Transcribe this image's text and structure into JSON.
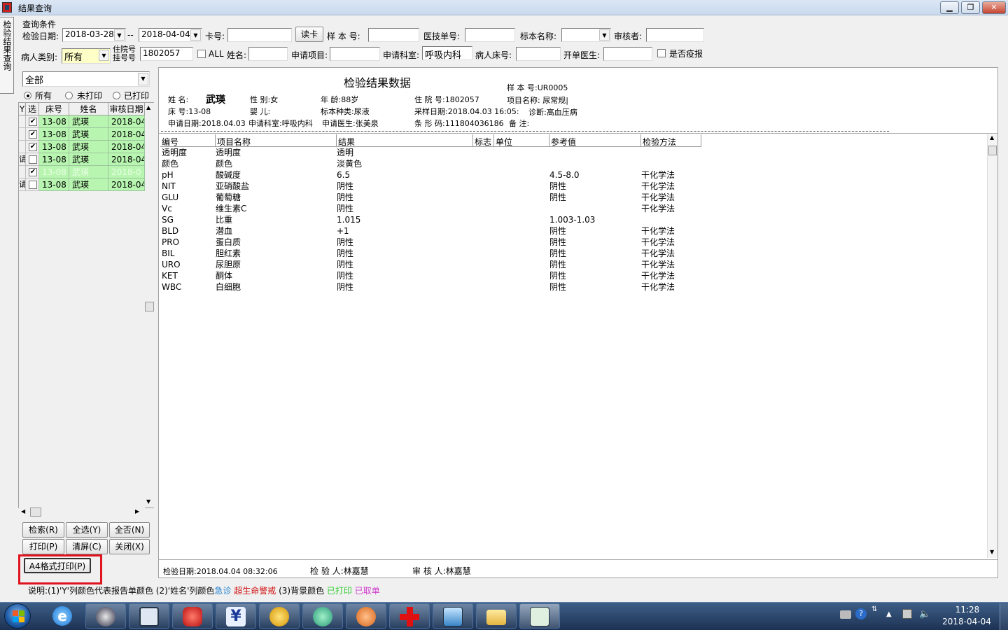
{
  "window": {
    "title": "结果查询",
    "minimize": "▁",
    "maximize": "❐",
    "close": "✕"
  },
  "side_tab": "检验结果查询",
  "query": {
    "group_title": "查询条件",
    "check_date_label": "检验日期:",
    "date_from": "2018-03-28",
    "date_sep": "--",
    "date_to": "2018-04-04",
    "card_label": "卡号:",
    "card_value": "",
    "read_card": "读卡",
    "sample_no_label": "样 本 号:",
    "sample_no_value": "",
    "tech_no_label": "医技单号:",
    "tech_no_value": "",
    "sample_name_label": "标本名称:",
    "sample_name_value": "",
    "reviewer_label": "审核者:",
    "reviewer_value": "",
    "patient_type_label": "病人类别:",
    "patient_type_value": "所有",
    "inpatient_label_1": "住院号",
    "inpatient_label_2": "挂号号",
    "inpatient_value": "1802057",
    "all_label": "ALL",
    "name_label": "姓名:",
    "name_value": "",
    "request_item_label": "申请项目:",
    "request_item_value": "",
    "request_dept_label": "申请科室:",
    "request_dept_value": "呼吸内科",
    "bed_label": "病人床号:",
    "bed_value": "",
    "doctor_label": "开单医生:",
    "doctor_value": "",
    "epidemic_label": "是否疫报"
  },
  "left": {
    "filter_value": "全部",
    "radio_all": "所有",
    "radio_unprinted": "未打印",
    "radio_printed": "已打印",
    "col_y": "Y",
    "col_sel": "选",
    "col_bed": "床号",
    "col_name": "姓名",
    "col_date": "审核日期",
    "rows": [
      {
        "y": "",
        "checked": "✔",
        "bed": "13-08",
        "name": "武瑛",
        "date": "2018-04"
      },
      {
        "y": "",
        "checked": "✔",
        "bed": "13-08",
        "name": "武瑛",
        "date": "2018-04"
      },
      {
        "y": "",
        "checked": "✔",
        "bed": "13-08",
        "name": "武瑛",
        "date": "2018-04"
      },
      {
        "y": "请",
        "checked": "",
        "bed": "13-08",
        "name": "武瑛",
        "date": "2018-04"
      },
      {
        "y": "",
        "checked": "✔",
        "bed": "13-08",
        "name": "武瑛",
        "date": "2018-0"
      },
      {
        "y": "请",
        "checked": "",
        "bed": "13-08",
        "name": "武瑛",
        "date": "2018-04"
      }
    ],
    "btn_search": "检索(R)",
    "btn_select_all": "全选(Y)",
    "btn_select_none": "全否(N)",
    "btn_print": "打印(P)",
    "btn_clear": "清屏(C)",
    "btn_close": "关闭(X)",
    "btn_a4": "A4格式打印(P)"
  },
  "report": {
    "title": "检验结果数据",
    "sample_no": "样 本 号:UR0005",
    "name_label": "姓    名:",
    "name_value": "武瑛",
    "sex": "性      别:女",
    "age": "年      龄:88岁",
    "inpatient": "住 院 号:1802057",
    "item_name": "项目名称: 尿常规|",
    "bed": "床    号:13-08",
    "infant": "婴      儿:",
    "sample_type": "标本种类:尿液",
    "collect_date": "采样日期:2018.04.03 16:05:",
    "diagnosis": "诊断:高血压病",
    "request_date": "申请日期:2018.04.03",
    "request_dept": "申请科室:呼吸内科",
    "request_doctor": "申请医生:张美泉",
    "barcode": "条 形 码:111804036186",
    "remark": "备      注:",
    "columns": [
      "编号",
      "项目名称",
      "结果",
      "标志",
      "单位",
      "参考值",
      "检验方法"
    ],
    "rows": [
      {
        "code": "透明度",
        "item": "透明度",
        "result": "透明",
        "flag": "",
        "unit": "",
        "ref": "",
        "method": ""
      },
      {
        "code": "颜色",
        "item": "颜色",
        "result": "淡黄色",
        "flag": "",
        "unit": "",
        "ref": "",
        "method": ""
      },
      {
        "code": "pH",
        "item": "酸碱度",
        "result": "6.5",
        "flag": "",
        "unit": "",
        "ref": "4.5-8.0",
        "method": "干化学法"
      },
      {
        "code": "NIT",
        "item": "亚硝酸盐",
        "result": "阴性",
        "flag": "",
        "unit": "",
        "ref": "阴性",
        "method": "干化学法"
      },
      {
        "code": "GLU",
        "item": "葡萄糖",
        "result": "阴性",
        "flag": "",
        "unit": "",
        "ref": "阴性",
        "method": "干化学法"
      },
      {
        "code": "Vc",
        "item": "维生素C",
        "result": "阴性",
        "flag": "",
        "unit": "",
        "ref": "",
        "method": "干化学法"
      },
      {
        "code": "SG",
        "item": "比重",
        "result": "1.015",
        "flag": "",
        "unit": "",
        "ref": "1.003-1.03",
        "method": ""
      },
      {
        "code": "BLD",
        "item": "潜血",
        "result": "+1",
        "flag": "",
        "unit": "",
        "ref": "阴性",
        "method": "干化学法"
      },
      {
        "code": "PRO",
        "item": "蛋白质",
        "result": "阴性",
        "flag": "",
        "unit": "",
        "ref": "阴性",
        "method": "干化学法"
      },
      {
        "code": "BIL",
        "item": "胆红素",
        "result": "阴性",
        "flag": "",
        "unit": "",
        "ref": "阴性",
        "method": "干化学法"
      },
      {
        "code": "URO",
        "item": "尿胆原",
        "result": "阴性",
        "flag": "",
        "unit": "",
        "ref": "阴性",
        "method": "干化学法"
      },
      {
        "code": "KET",
        "item": "酮体",
        "result": "阴性",
        "flag": "",
        "unit": "",
        "ref": "阴性",
        "method": "干化学法"
      },
      {
        "code": "WBC",
        "item": "白细胞",
        "result": "阴性",
        "flag": "",
        "unit": "",
        "ref": "阴性",
        "method": "干化学法"
      }
    ],
    "footer_date": "检验日期:2018.04.04 08:32:06",
    "footer_tester": "检 验 人:林嘉慧",
    "footer_reviewer": "审 核 人:林嘉慧"
  },
  "legend": {
    "part1": "说明:(1)'Y'列颜色代表报告单颜色   (2)'姓名'列颜色",
    "urgent": "急诊",
    "critical": "超生命警戒",
    "part3": "   (3)背景颜色",
    "printed": "已打印",
    "cancelled": "已取单",
    "colors": {
      "urgent": "#1e7fd0",
      "critical": "#d01010",
      "printed": "#33cc33",
      "cancelled": "#d040d0"
    }
  },
  "taskbar": {
    "icons": [
      "start-orb-icon",
      "ie-icon",
      "compass-icon",
      "database-tool-icon",
      "red-app-icon",
      "yen-icon",
      "gold-coin-icon",
      "network-icon",
      "orange-app-icon",
      "red-cross-icon",
      "remote-desktop-icon",
      "folder-icon",
      "person-card-icon"
    ],
    "time": "11:28",
    "date": "2018-04-04"
  }
}
